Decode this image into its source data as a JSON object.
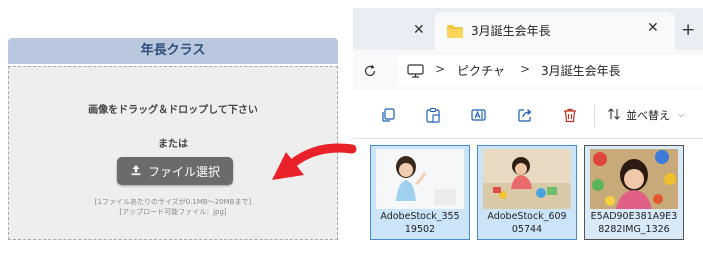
{
  "upload": {
    "class_title": "年長クラス",
    "drop_text": "画像をドラッグ＆ドロップして下さい",
    "or_text": "または",
    "select_button": "ファイル選択",
    "note_line1": "[1ファイルあたりのサイズが0.1MB～20MBまで]",
    "note_line2": "[アップロード可能ファイル：jpg]"
  },
  "explorer": {
    "tab_title": "3月誕生会年長",
    "breadcrumb": [
      "ピクチャ",
      "3月誕生会年長"
    ],
    "sort_label": "並べ替え",
    "files": [
      {
        "name_line1": "AdobeStock_355",
        "name_line2": "19502"
      },
      {
        "name_line1": "AdobeStock_609",
        "name_line2": "05744"
      },
      {
        "name_line1": "E5AD90E381A9E3",
        "name_line2": "8282IMG_1326"
      }
    ]
  },
  "colors": {
    "header_bg": "#b9c8df",
    "header_text": "#2f4f7a",
    "button_bg": "#6b6b6b",
    "arrow_red": "#e8212a",
    "selection_bg": "#cce4f7",
    "selection_border": "#4a8ad4"
  },
  "icons": [
    "upload-icon",
    "folder-icon",
    "close-icon",
    "plus-icon",
    "refresh-icon",
    "monitor-icon",
    "copy-icon",
    "paste-icon",
    "rename-icon",
    "share-icon",
    "delete-icon",
    "sort-icon",
    "curved-arrow-icon"
  ]
}
